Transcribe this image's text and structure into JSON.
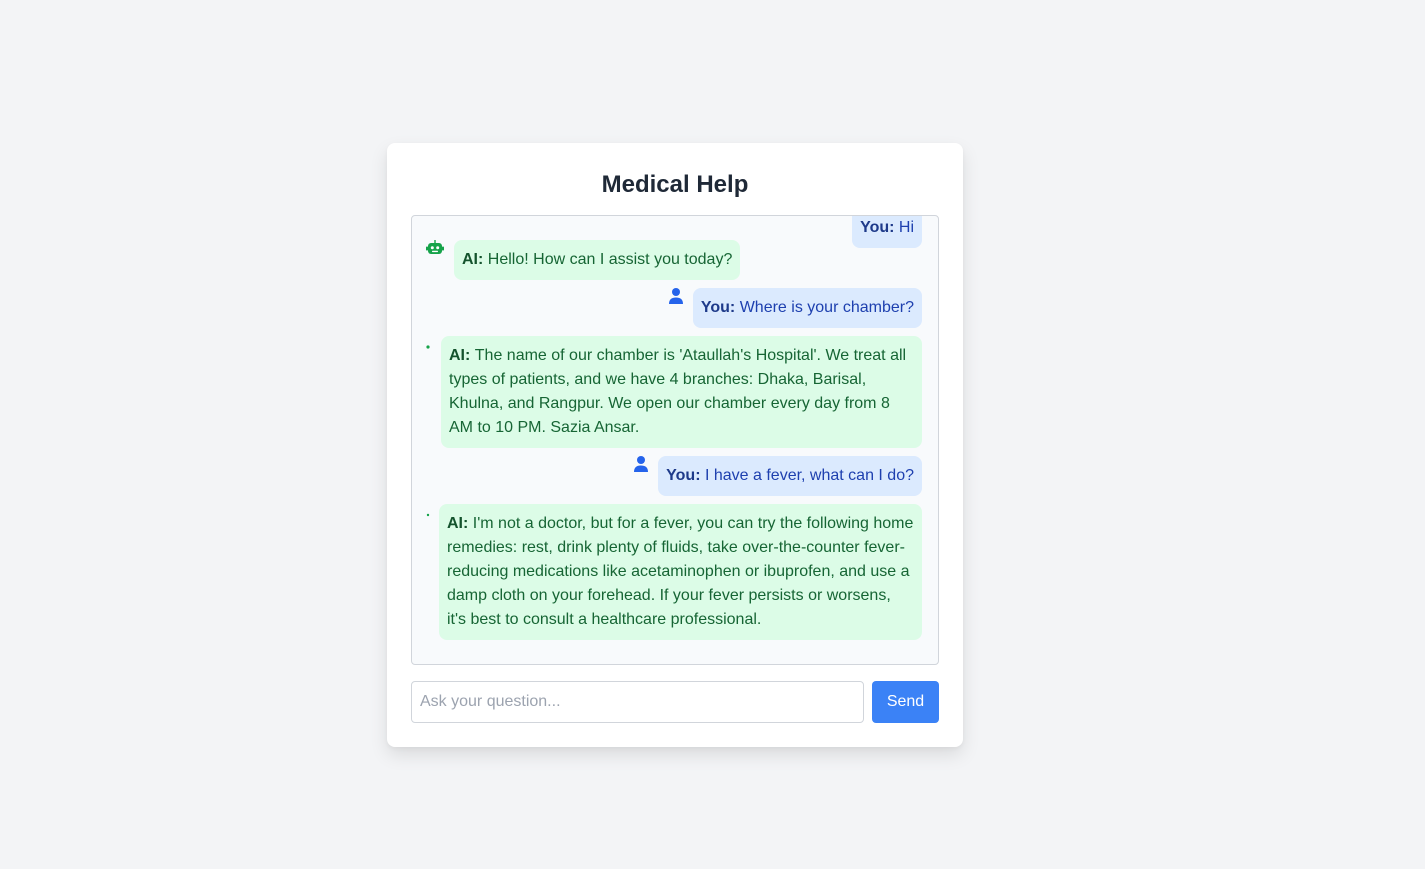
{
  "app": {
    "title": "Medical Help"
  },
  "chat": {
    "messages": [
      {
        "role": "user",
        "speaker": "You:",
        "text": "Hi"
      },
      {
        "role": "ai",
        "speaker": "AI:",
        "text": "Hello! How can I assist you today?"
      },
      {
        "role": "user",
        "speaker": "You:",
        "text": "Where is your chamber?"
      },
      {
        "role": "ai",
        "speaker": "AI:",
        "text": "The name of our chamber is 'Ataullah's Hospital'. We treat all types of patients, and we have 4 branches: Dhaka, Barisal, Khulna, and Rangpur. We open our chamber every day from 8 AM to 10 PM. Sazia Ansar."
      },
      {
        "role": "user",
        "speaker": "You:",
        "text": "I have a fever, what can I do?"
      },
      {
        "role": "ai",
        "speaker": "AI:",
        "text": "I'm not a doctor, but for a fever, you can try the following home remedies: rest, drink plenty of fluids, take over-the-counter fever-reducing medications like acetaminophen or ibuprofen, and use a damp cloth on your forehead. If your fever persists or worsens, it's best to consult a healthcare professional."
      }
    ]
  },
  "input": {
    "placeholder": "Ask your question...",
    "value": ""
  },
  "send": {
    "label": "Send"
  },
  "icons": {
    "user": "user-icon",
    "ai": "robot-icon"
  },
  "colors": {
    "accent": "#3b82f6",
    "user_bubble": "#dbeafe",
    "ai_bubble": "#dcfce7",
    "user_icon": "#2563eb",
    "ai_icon": "#16a34a"
  }
}
